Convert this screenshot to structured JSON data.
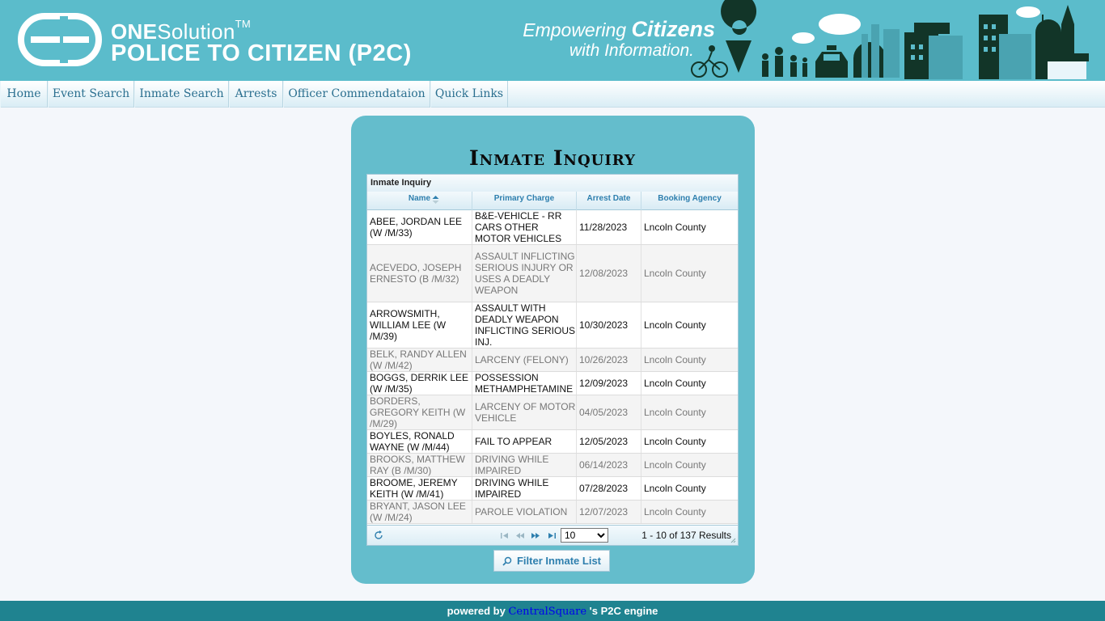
{
  "header": {
    "brand_prefix": "ONE",
    "brand_suffix": "Solution",
    "brand_tm": "TM",
    "product": "POLICE TO CITIZEN (P2C)",
    "tagline_a": "Empowering ",
    "tagline_b": "Citizens",
    "tagline_c": "with Information."
  },
  "nav": [
    {
      "label": "Home"
    },
    {
      "label": "Event Search"
    },
    {
      "label": "Inmate Search"
    },
    {
      "label": "Arrests"
    },
    {
      "label": "Officer Commendataion"
    },
    {
      "label": "Quick Links"
    }
  ],
  "page": {
    "title": "Inmate Inquiry"
  },
  "grid": {
    "caption": "Inmate Inquiry",
    "columns": [
      "Name",
      "Primary Charge",
      "Arrest Date",
      "Booking Agency"
    ],
    "rows": [
      {
        "name": "ABEE, JORDAN LEE (W /M/33)",
        "charge": "B&E-VEHICLE - RR CARS OTHER MOTOR VEHICLES",
        "date": "11/28/2023",
        "agency": "Lncoln County"
      },
      {
        "name": "ACEVEDO, JOSEPH ERNESTO (B /M/32)",
        "charge": "ASSAULT INFLICTING SERIOUS INJURY OR USES A DEADLY WEAPON",
        "date": "12/08/2023",
        "agency": "Lncoln County"
      },
      {
        "name": "ARROWSMITH, WILLIAM LEE (W /M/39)",
        "charge": "ASSAULT WITH DEADLY WEAPON INFLICTING SERIOUS INJ.",
        "date": "10/30/2023",
        "agency": "Lncoln County"
      },
      {
        "name": "BELK, RANDY ALLEN (W /M/42)",
        "charge": "LARCENY (FELONY)",
        "date": "10/26/2023",
        "agency": "Lncoln County"
      },
      {
        "name": "BOGGS, DERRIK LEE (W /M/35)",
        "charge": "POSSESSION METHAMPHETAMINE",
        "date": "12/09/2023",
        "agency": "Lncoln County"
      },
      {
        "name": "BORDERS, GREGORY KEITH (W /M/29)",
        "charge": "LARCENY OF MOTOR VEHICLE",
        "date": "04/05/2023",
        "agency": "Lncoln County"
      },
      {
        "name": "BOYLES, RONALD WAYNE (W /M/44)",
        "charge": "FAIL TO APPEAR",
        "date": "12/05/2023",
        "agency": "Lncoln County"
      },
      {
        "name": "BROOKS, MATTHEW RAY (B /M/30)",
        "charge": "DRIVING WHILE IMPAIRED",
        "date": "06/14/2023",
        "agency": "Lncoln County"
      },
      {
        "name": "BROOME, JEREMY KEITH (W /M/41)",
        "charge": "DRIVING WHILE IMPAIRED",
        "date": "07/28/2023",
        "agency": "Lncoln County"
      },
      {
        "name": "BRYANT, JASON LEE (W /M/24)",
        "charge": "PAROLE VIOLATION",
        "date": "12/07/2023",
        "agency": "Lncoln County"
      }
    ],
    "page_size": "10",
    "result_info": "1 - 10 of 137 Results"
  },
  "filter_button": "Filter Inmate List",
  "footer": {
    "prefix": "powered by ",
    "link": "CentralSquare",
    "suffix": " 's P2C engine"
  },
  "colors": {
    "header_bg": "#5bbccb",
    "panel_bg": "#64bdcc",
    "link_blue": "#2e7fae",
    "footer_bg": "#1f8390",
    "skyline_dark": "#123528"
  },
  "icons": [
    "logo-icon",
    "skyline-illustration",
    "sort-asc-icon",
    "refresh-icon",
    "first-page-icon",
    "prev-page-icon",
    "next-page-icon",
    "last-page-icon",
    "search-icon",
    "resize-grip-icon"
  ]
}
